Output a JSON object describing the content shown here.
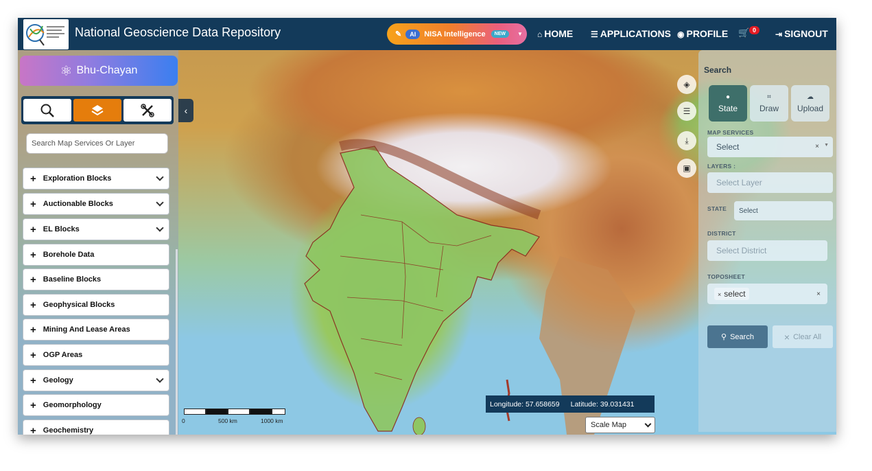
{
  "header": {
    "title": "National Geoscience Data Repository",
    "nisa": {
      "ai_badge": "AI",
      "label": "NISA Intelligence",
      "new_badge": "NEW"
    },
    "nav": {
      "home": "HOME",
      "applications": "APPLICATIONS",
      "profile": "PROFILE",
      "signout": "SIGNOUT"
    },
    "cart_count": "0"
  },
  "left_panel": {
    "brand": "Bhu-Chayan",
    "tools": [
      {
        "icon": "search-icon",
        "active": false
      },
      {
        "icon": "layers-icon",
        "active": true
      },
      {
        "icon": "tools-icon",
        "active": false
      }
    ],
    "search_placeholder": "Search Map Services Or Layer",
    "layers": [
      {
        "label": "Exploration Blocks",
        "expandable": true
      },
      {
        "label": "Auctionable Blocks",
        "expandable": true
      },
      {
        "label": "EL Blocks",
        "expandable": true
      },
      {
        "label": "Borehole Data",
        "expandable": false
      },
      {
        "label": "Baseline Blocks",
        "expandable": false
      },
      {
        "label": "Geophysical Blocks",
        "expandable": false
      },
      {
        "label": "Mining And Lease Areas",
        "expandable": false
      },
      {
        "label": "OGP Areas",
        "expandable": false
      },
      {
        "label": "Geology",
        "expandable": true
      },
      {
        "label": "Geomorphology",
        "expandable": false
      },
      {
        "label": "Geochemistry",
        "expandable": false
      }
    ]
  },
  "search_panel": {
    "title": "Search",
    "tabs": [
      {
        "label": "State",
        "icon": "map-pin-icon",
        "active": true
      },
      {
        "label": "Draw",
        "icon": "draw-icon",
        "active": false
      },
      {
        "label": "Upload",
        "icon": "upload-cloud-icon",
        "active": false
      }
    ],
    "map_services_label": "MAP SERVICES",
    "map_services_value": "Select",
    "layers_label": "LAYERS :",
    "layers_placeholder": "Select Layer",
    "state_label": "STATE",
    "state_value": "Select",
    "district_label": "DISTRICT",
    "district_placeholder": "Select District",
    "toposheet_label": "TOPOSHEET",
    "toposheet_tag": "select",
    "search_button": "Search",
    "clear_button": "Clear All"
  },
  "map": {
    "scale_labels": [
      "0",
      "500 km",
      "1000 km"
    ],
    "longitude_label": "Longitude:",
    "longitude": "57.658659",
    "latitude_label": "Latitude:",
    "latitude": "39.031431",
    "basemap": "Scale Map"
  },
  "colors": {
    "header_bg": "#133a5a",
    "active_tool": "#e57d0c",
    "active_tab": "#3e6f6a",
    "search_button": "#4b7490"
  }
}
